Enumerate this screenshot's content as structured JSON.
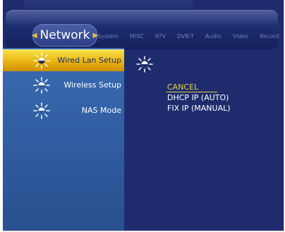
{
  "header": {
    "active_tab": "Network",
    "tabs": [
      "System",
      "MISC",
      "ATV",
      "DVB-T",
      "Audio",
      "Video",
      "Record"
    ]
  },
  "sidebar": {
    "items": [
      {
        "label": "Wired Lan Setup",
        "icon": "sun-icon",
        "selected": true
      },
      {
        "label": "Wireless Setup",
        "icon": "sun-icon",
        "selected": false
      },
      {
        "label": "NAS Mode",
        "icon": "sun-icon",
        "selected": false
      }
    ]
  },
  "submenu": {
    "options": [
      "CANCEL",
      "DHCP IP (AUTO)",
      "FIX IP (MANUAL)"
    ],
    "selected": "CANCEL"
  },
  "colors": {
    "background": "#1e2c6e",
    "sidebar": "#2f5a9e",
    "highlight": "#e9b311",
    "selected_text": "#e8cf4a"
  }
}
